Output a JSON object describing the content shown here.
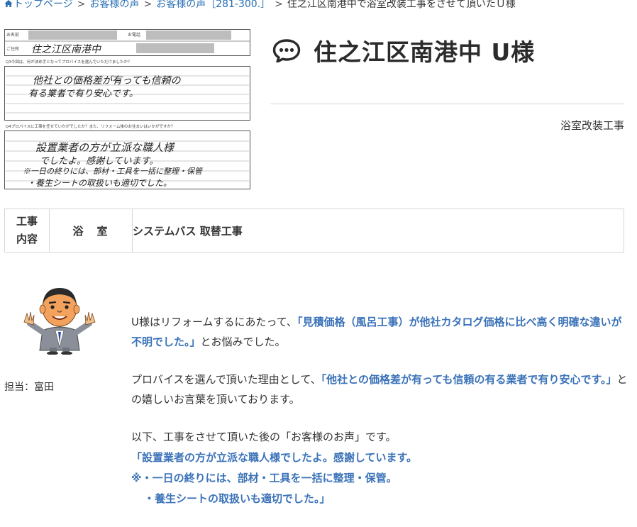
{
  "breadcrumb": {
    "home": "トップページ",
    "level1": "お客様の声",
    "level2": "お客様の声［281-300.］",
    "current": "住之江区南港中で浴室改装工事をさせて頂いたＵ様"
  },
  "scan": {
    "name_label": "お名前",
    "phone_label": "お電話",
    "address_label": "ご住所",
    "address_handwritten": "住之江区南港中",
    "q3": "Q3今回は、何が決め手となってプロバイスを選んでいただけましたか？",
    "a3_line1": "他社との価格差が有っても信頼の",
    "a3_line2": "有る業者で有り安心です。",
    "q4": "Q4プロバイスに工事を任せていかがでしたか？また、リフォーム後のお住まいはいかがですか？",
    "a4_line1": "設置業者の方が立派な職人様",
    "a4_line2": "でしたよ。感謝しています。",
    "a4_line3": "※一日の終りには、部材・工具を一括に整理・保管",
    "a4_line4": "・養生シートの取扱いも適切でした。"
  },
  "title": "住之江区南港中 U様",
  "work_type": "浴室改装工事",
  "work_table": {
    "head_line1": "工事",
    "head_line2": "内容",
    "category": "浴　室",
    "detail": "システムバス 取替工事"
  },
  "staff_caption": "担当：富田",
  "comments": {
    "p1_pre": "U様はリフォームするにあたって、",
    "p1_quote": "「見積価格（風呂工事）が他社カタログ価格に比べ高く明確な違いが不明でした。」",
    "p1_post": "とお悩みでした。",
    "p2_pre": "プロバイスを選んで頂いた理由として、",
    "p2_quote": "「他社との価格差が有っても信頼の有る業者で有り安心です。」",
    "p2_post": "との嬉しいお言葉を頂いております。",
    "p3_intro": "以下、工事をさせて頂いた後の「お客様のお声」です。",
    "p3_line1": "「設置業者の方が立派な職人様でしたよ。感謝しています。",
    "p3_line2": "※・一日の終りには、部材・工具を一括に整理・保管。",
    "p3_line3": "・養生シートの取扱いも適切でした。」"
  },
  "colors": {
    "link": "#2a6fb5",
    "quote": "#3a72b8",
    "text": "#333333",
    "border": "#d6d6d6"
  }
}
